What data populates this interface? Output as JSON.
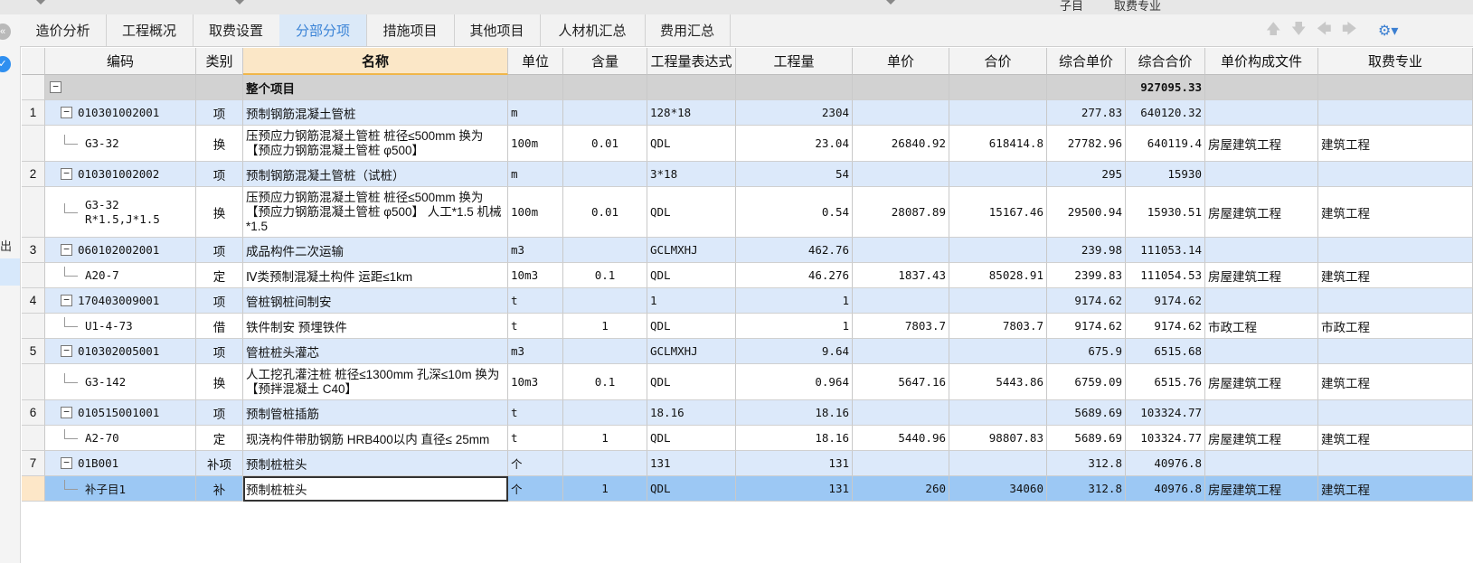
{
  "topstrip": {
    "hint_left": "子目",
    "hint_right": "取费专业"
  },
  "rail": {
    "glyph": "出"
  },
  "tabs": [
    {
      "label": "造价分析"
    },
    {
      "label": "工程概况"
    },
    {
      "label": "取费设置"
    },
    {
      "label": "分部分项",
      "active": true
    },
    {
      "label": "措施项目"
    },
    {
      "label": "其他项目"
    },
    {
      "label": "人材机汇总"
    },
    {
      "label": "费用汇总"
    }
  ],
  "colors": {
    "item_row": "#dce9fa",
    "total_row": "#d2d2d2",
    "selected_row": "#9cc8f4",
    "active_tab": "#3a83d6"
  },
  "headers": {
    "seq": "",
    "code": "编码",
    "type": "类别",
    "name": "名称",
    "unit": "单位",
    "content": "含量",
    "expr": "工程量表达式",
    "qty": "工程量",
    "price": "单价",
    "total": "合价",
    "comp_price": "综合单价",
    "comp_total": "综合合价",
    "price_file": "单价构成文件",
    "fee_major": "取费专业"
  },
  "rows": [
    {
      "kind": "total",
      "seq": "",
      "code": "",
      "type": "",
      "name": "整个项目",
      "unit": "",
      "content": "",
      "expr": "",
      "qty": "",
      "price": "",
      "total": "",
      "comp_price": "",
      "comp_total": "927095.33",
      "price_file": "",
      "fee_major": ""
    },
    {
      "kind": "item",
      "seq": "1",
      "code": "010301002001",
      "type": "项",
      "name": "预制钢筋混凝土管桩",
      "unit": "m",
      "content": "",
      "expr": "128*18",
      "qty": "2304",
      "price": "",
      "total": "",
      "comp_price": "277.83",
      "comp_total": "640120.32",
      "price_file": "",
      "fee_major": ""
    },
    {
      "kind": "sub",
      "seq": "",
      "code": "G3-32",
      "type": "换",
      "name": "压预应力钢筋混凝土管桩 桩径≤500mm  换为【预应力钢筋混凝土管桩 φ500】",
      "unit": "100m",
      "content": "0.01",
      "expr": "QDL",
      "qty": "23.04",
      "price": "26840.92",
      "total": "618414.8",
      "comp_price": "27782.96",
      "comp_total": "640119.4",
      "price_file": "房屋建筑工程",
      "fee_major": "建筑工程"
    },
    {
      "kind": "item",
      "seq": "2",
      "code": "010301002002",
      "type": "项",
      "name": "预制钢筋混凝土管桩（试桩）",
      "unit": "m",
      "content": "",
      "expr": "3*18",
      "qty": "54",
      "price": "",
      "total": "",
      "comp_price": "295",
      "comp_total": "15930",
      "price_file": "",
      "fee_major": ""
    },
    {
      "kind": "sub",
      "seq": "",
      "code": "G3-32 R*1.5,J*1.5",
      "type": "换",
      "name": "压预应力钢筋混凝土管桩 桩径≤500mm  换为【预应力钢筋混凝土管桩 φ500】  人工*1.5  机械*1.5",
      "unit": "100m",
      "content": "0.01",
      "expr": "QDL",
      "qty": "0.54",
      "price": "28087.89",
      "total": "15167.46",
      "comp_price": "29500.94",
      "comp_total": "15930.51",
      "price_file": "房屋建筑工程",
      "fee_major": "建筑工程"
    },
    {
      "kind": "item",
      "seq": "3",
      "code": "060102002001",
      "type": "项",
      "name": "成品构件二次运输",
      "unit": "m3",
      "content": "",
      "expr": "GCLMXHJ",
      "qty": "462.76",
      "price": "",
      "total": "",
      "comp_price": "239.98",
      "comp_total": "111053.14",
      "price_file": "",
      "fee_major": ""
    },
    {
      "kind": "sub",
      "seq": "",
      "code": "A20-7",
      "type": "定",
      "name": "Ⅳ类预制混凝土构件 运距≤1km",
      "unit": "10m3",
      "content": "0.1",
      "expr": "QDL",
      "qty": "46.276",
      "price": "1837.43",
      "total": "85028.91",
      "comp_price": "2399.83",
      "comp_total": "111054.53",
      "price_file": "房屋建筑工程",
      "fee_major": "建筑工程"
    },
    {
      "kind": "item",
      "seq": "4",
      "code": "170403009001",
      "type": "项",
      "name": "管桩钢桩间制安",
      "unit": "t",
      "content": "",
      "expr": "1",
      "qty": "1",
      "price": "",
      "total": "",
      "comp_price": "9174.62",
      "comp_total": "9174.62",
      "price_file": "",
      "fee_major": ""
    },
    {
      "kind": "sub",
      "seq": "",
      "code": "U1-4-73",
      "type": "借",
      "name": "铁件制安 预埋铁件",
      "unit": "t",
      "content": "1",
      "expr": "QDL",
      "qty": "1",
      "price": "7803.7",
      "total": "7803.7",
      "comp_price": "9174.62",
      "comp_total": "9174.62",
      "price_file": "市政工程",
      "fee_major": "市政工程"
    },
    {
      "kind": "item",
      "seq": "5",
      "code": "010302005001",
      "type": "项",
      "name": "管桩桩头灌芯",
      "unit": "m3",
      "content": "",
      "expr": "GCLMXHJ",
      "qty": "9.64",
      "price": "",
      "total": "",
      "comp_price": "675.9",
      "comp_total": "6515.68",
      "price_file": "",
      "fee_major": ""
    },
    {
      "kind": "sub",
      "seq": "",
      "code": "G3-142",
      "type": "换",
      "name": "人工挖孔灌注桩 桩径≤1300mm 孔深≤10m 换为【预拌混凝土 C40】",
      "unit": "10m3",
      "content": "0.1",
      "expr": "QDL",
      "qty": "0.964",
      "price": "5647.16",
      "total": "5443.86",
      "comp_price": "6759.09",
      "comp_total": "6515.76",
      "price_file": "房屋建筑工程",
      "fee_major": "建筑工程"
    },
    {
      "kind": "item",
      "seq": "6",
      "code": "010515001001",
      "type": "项",
      "name": "预制管桩插筋",
      "unit": "t",
      "content": "",
      "expr": "18.16",
      "qty": "18.16",
      "price": "",
      "total": "",
      "comp_price": "5689.69",
      "comp_total": "103324.77",
      "price_file": "",
      "fee_major": ""
    },
    {
      "kind": "sub",
      "seq": "",
      "code": "A2-70",
      "type": "定",
      "name": "现浇构件带肋钢筋 HRB400以内 直径≤ 25mm",
      "unit": "t",
      "content": "1",
      "expr": "QDL",
      "qty": "18.16",
      "price": "5440.96",
      "total": "98807.83",
      "comp_price": "5689.69",
      "comp_total": "103324.77",
      "price_file": "房屋建筑工程",
      "fee_major": "建筑工程"
    },
    {
      "kind": "item",
      "seq": "7",
      "code": "01B001",
      "type": "补项",
      "name": "预制桩桩头",
      "unit": "个",
      "content": "",
      "expr": "131",
      "qty": "131",
      "price": "",
      "total": "",
      "comp_price": "312.8",
      "comp_total": "40976.8",
      "price_file": "",
      "fee_major": ""
    },
    {
      "kind": "selected",
      "seq": "",
      "code": "补子目1",
      "type": "补",
      "name": "预制桩桩头",
      "unit": "个",
      "content": "1",
      "expr": "QDL",
      "qty": "131",
      "price": "260",
      "total": "34060",
      "comp_price": "312.8",
      "comp_total": "40976.8",
      "price_file": "房屋建筑工程",
      "fee_major": "建筑工程"
    }
  ]
}
